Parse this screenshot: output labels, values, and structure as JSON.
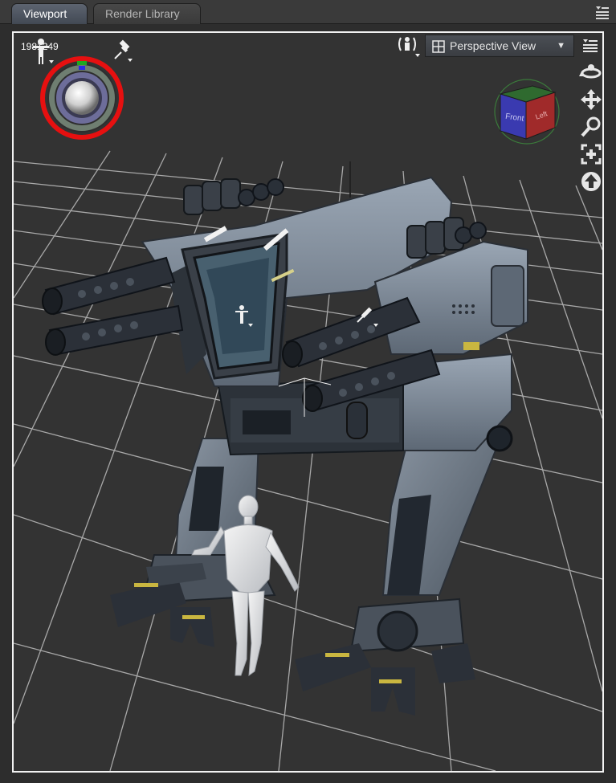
{
  "tabs": [
    {
      "label": "Viewport",
      "active": true
    },
    {
      "label": "Render Library",
      "active": false
    }
  ],
  "viewport": {
    "coordinates": "1981249",
    "view_mode": "Perspective View",
    "view_cube_faces": {
      "front": "Front",
      "left": "Left"
    },
    "colors": {
      "frame": "#f2f2f2",
      "background": "#333333",
      "light_ring": "#e61010"
    }
  },
  "icons": [
    "panel-menu-icon",
    "figure-select-icon",
    "pin-icon",
    "light-sphere-icon",
    "camera-select-icon",
    "grid-icon",
    "orbit-icon",
    "pan-icon",
    "zoom-icon",
    "frame-icon",
    "home-icon"
  ]
}
